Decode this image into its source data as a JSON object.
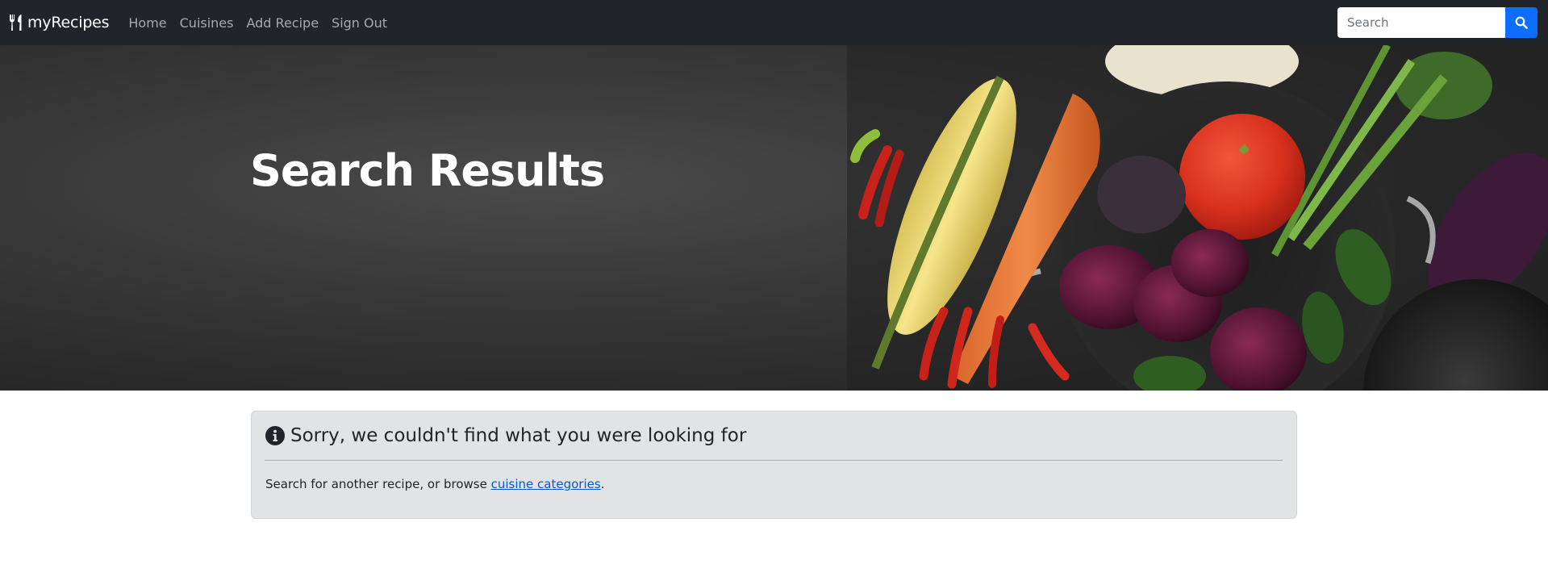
{
  "navbar": {
    "brand": "myRecipes",
    "brand_icon": "utensils-icon",
    "links": [
      "Home",
      "Cuisines",
      "Add Recipe",
      "Sign Out"
    ],
    "search": {
      "placeholder": "Search",
      "value": "",
      "button_icon": "search-icon"
    }
  },
  "hero": {
    "title": "Search Results"
  },
  "alert": {
    "icon": "info-circle-icon",
    "heading": "Sorry, we couldn't find what you were looking for",
    "body_prefix": "Search for another recipe, or browse ",
    "link_text": "cuisine categories",
    "body_suffix": "."
  },
  "colors": {
    "navbar_bg": "#212529",
    "accent": "#0d6efd",
    "alert_bg": "#e2e3e5",
    "link": "#0a58ca"
  }
}
